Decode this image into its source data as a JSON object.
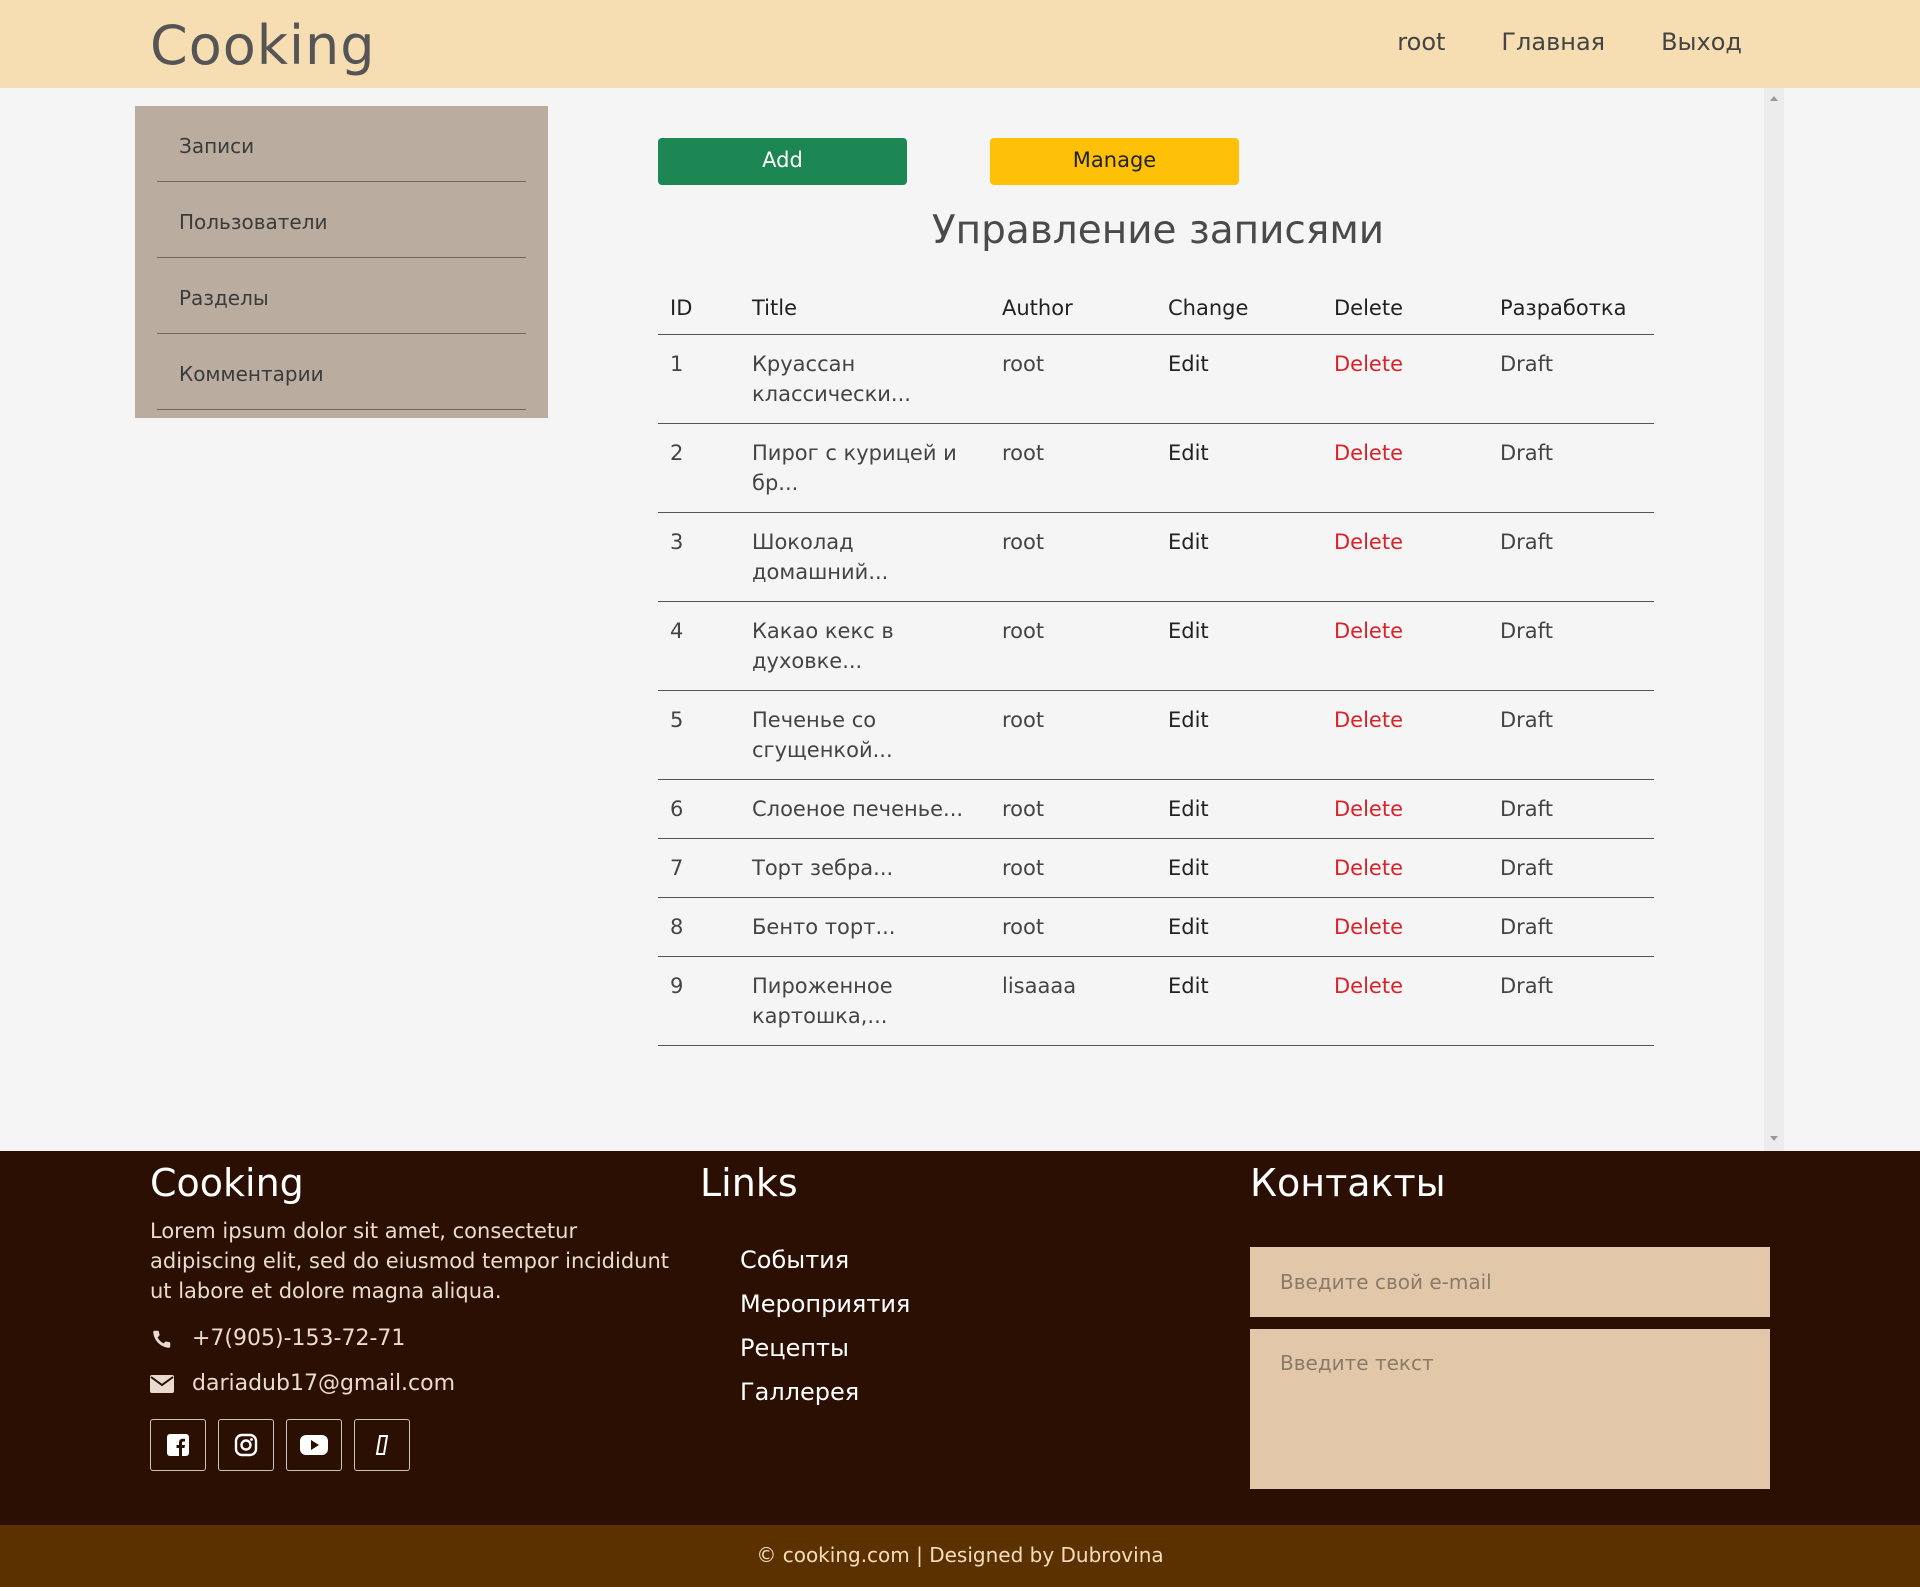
{
  "header": {
    "logo": "Cooking",
    "nav": [
      "root",
      "Главная",
      "Выход"
    ]
  },
  "sidebar": {
    "items": [
      {
        "label": "Записи"
      },
      {
        "label": "Пользователи"
      },
      {
        "label": "Разделы"
      },
      {
        "label": "Комментарии"
      }
    ]
  },
  "toolbar": {
    "add_label": "Add",
    "manage_label": "Manage",
    "add_color": "#1c8753",
    "manage_color": "#ffc107"
  },
  "main": {
    "title": "Управление записями",
    "columns": [
      "ID",
      "Title",
      "Author",
      "Change",
      "Delete",
      "Разработка"
    ],
    "rows": [
      {
        "id": "1",
        "title": "Круассан классически...",
        "author": "root",
        "change": "Edit",
        "delete": "Delete",
        "status": "Draft"
      },
      {
        "id": "2",
        "title": "Пирог с курицей и бр...",
        "author": "root",
        "change": "Edit",
        "delete": "Delete",
        "status": "Draft"
      },
      {
        "id": "3",
        "title": "Шоколад домашний...",
        "author": "root",
        "change": "Edit",
        "delete": "Delete",
        "status": "Draft"
      },
      {
        "id": "4",
        "title": "Какао кекс в духовке...",
        "author": "root",
        "change": "Edit",
        "delete": "Delete",
        "status": "Draft"
      },
      {
        "id": "5",
        "title": "Печенье со сгущенкой...",
        "author": "root",
        "change": "Edit",
        "delete": "Delete",
        "status": "Draft"
      },
      {
        "id": "6",
        "title": "Слоеное печенье...",
        "author": "root",
        "change": "Edit",
        "delete": "Delete",
        "status": "Draft"
      },
      {
        "id": "7",
        "title": "Торт зебра...",
        "author": "root",
        "change": "Edit",
        "delete": "Delete",
        "status": "Draft"
      },
      {
        "id": "8",
        "title": "Бенто торт...",
        "author": "root",
        "change": "Edit",
        "delete": "Delete",
        "status": "Draft"
      },
      {
        "id": "9",
        "title": "Пироженное картошка,...",
        "author": "lisaaaa",
        "change": "Edit",
        "delete": "Delete",
        "status": "Draft"
      }
    ]
  },
  "footer": {
    "about_title": "Cooking",
    "about_text": "Lorem ipsum dolor sit amet, consectetur adipiscing elit, sed do eiusmod tempor incididunt ut labore et dolore magna aliqua.",
    "phone": "+7(905)-153-72-71",
    "email": "dariadub17@gmail.com",
    "socials": [
      "facebook-icon",
      "instagram-icon",
      "youtube-icon",
      "phone-icon"
    ],
    "links_title": "Links",
    "links": [
      "События",
      "Мероприятия",
      "Рецепты",
      "Галлерея"
    ],
    "contacts_title": "Контакты",
    "email_placeholder": "Введите свой e-mail",
    "message_placeholder": "Введите текст",
    "copyright": "© cooking.com | Designed by Dubrovina"
  }
}
